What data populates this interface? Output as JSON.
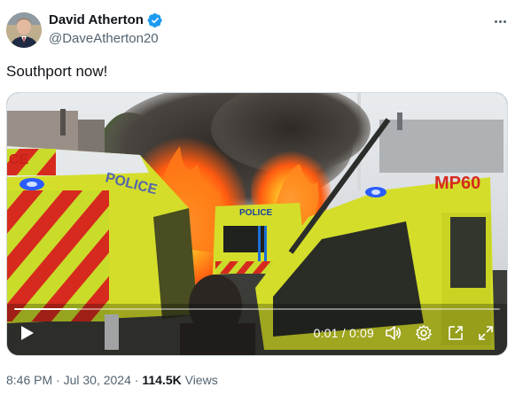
{
  "author": {
    "name": "David Atherton",
    "handle": "@DaveAtherton20",
    "verified_color": "#1d9bf0"
  },
  "tweet": {
    "text": "Southport now!"
  },
  "video": {
    "scene_text": {
      "left_van_lettering": "CE",
      "left_van_side_text": "POLICE",
      "center_van_lettering": "POLICE",
      "right_van_code": "MP60"
    },
    "current_time": "0:01",
    "separator": "/",
    "duration": "0:09",
    "progress_fraction": 0.13,
    "icons": [
      "play-icon",
      "volume-icon",
      "settings-icon",
      "picture-in-picture-icon",
      "fullscreen-icon"
    ]
  },
  "meta": {
    "time": "8:46 PM",
    "sep1": "·",
    "date": "Jul 30, 2024",
    "sep2": "·",
    "views_count": "114.5K",
    "views_label": "Views"
  },
  "colors": {
    "text_primary": "#0f1419",
    "text_secondary": "#536471",
    "verified_blue": "#1d9bf0",
    "hi_vis_yellow": "#d4de2a",
    "police_red": "#d62a1e",
    "fire_orange": "#ff6a10"
  }
}
